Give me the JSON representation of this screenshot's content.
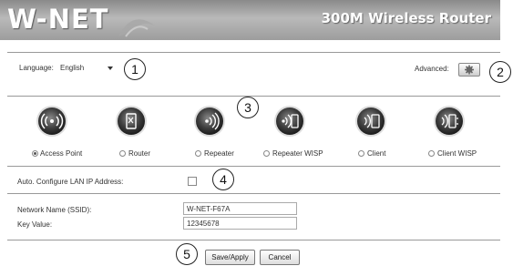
{
  "header": {
    "logo": "W-NET",
    "product": "300M Wireless Router"
  },
  "language": {
    "label": "Language:",
    "value": "English"
  },
  "advanced": {
    "label": "Advanced:"
  },
  "modes": [
    {
      "label": "Access Point",
      "selected": true,
      "icon": "access-point-icon"
    },
    {
      "label": "Router",
      "selected": false,
      "icon": "router-icon"
    },
    {
      "label": "Repeater",
      "selected": false,
      "icon": "repeater-icon"
    },
    {
      "label": "Repeater WISP",
      "selected": false,
      "icon": "repeater-wisp-icon"
    },
    {
      "label": "Client",
      "selected": false,
      "icon": "client-icon"
    },
    {
      "label": "Client WISP",
      "selected": false,
      "icon": "client-wisp-icon"
    }
  ],
  "lan": {
    "label": "Auto. Configure LAN IP Address:",
    "checked": false
  },
  "ssid": {
    "label": "Network Name (SSID):",
    "value": "W-NET-F67A"
  },
  "key": {
    "label": "Key Value:",
    "value": "12345678"
  },
  "buttons": {
    "save": "Save/Apply",
    "cancel": "Cancel"
  },
  "callouts": [
    "1",
    "2",
    "3",
    "4",
    "5"
  ]
}
